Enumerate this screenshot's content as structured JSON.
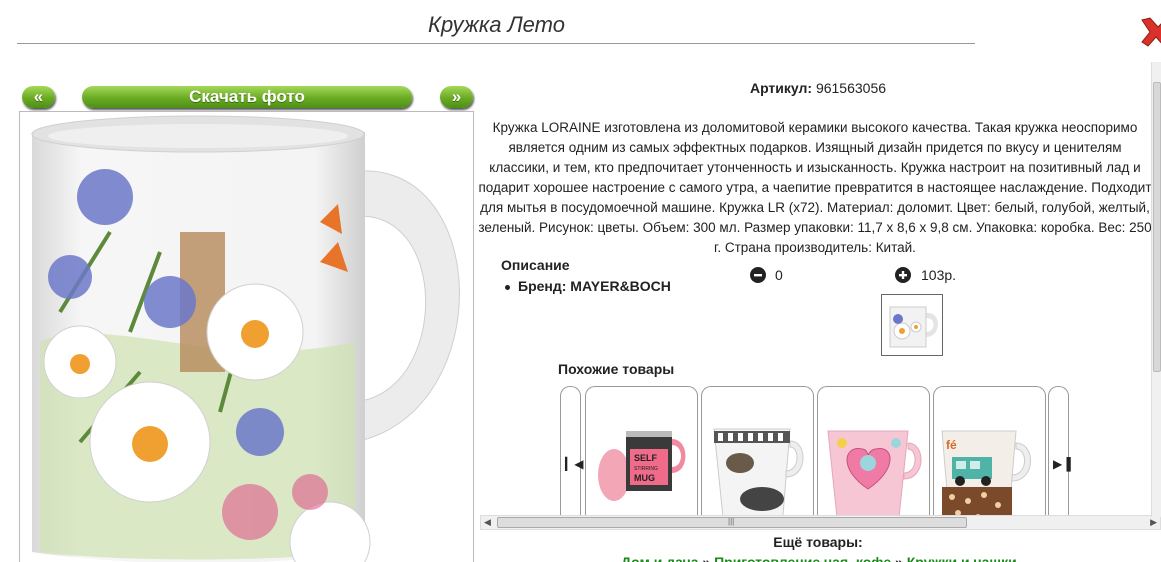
{
  "header": {
    "title": "Кружка Лето"
  },
  "gallery": {
    "prev_label": "«",
    "next_label": "»",
    "download_label": "Скачать фото"
  },
  "product": {
    "sku_label": "Артикул:",
    "sku_value": "961563056",
    "description": "Кружка LORAINE изготовлена из доломитовой керамики высокого качества. Такая кружка неоспоримо является одним из самых эффектных подарков. Изящный дизайн придется по вкусу и ценителям классики, и тем, кто предпочитает утонченность и изысканность. Кружка настроит на позитивный лад и подарит хорошее настроение с самого утра, а чаепитие превратится в настоящее наслаждение. Подходит для мытья в посудомоечной машине. Кружка LR (x72). Материал: доломит. Цвет: белый, голубой, желтый, зеленый. Рисунок: цветы. Объем: 300 мл. Размер упаковки: 11,7 х 8,6 х 9,8 см. Упаковка: коробка. Вес: 250 г. Страна производитель: Китай.",
    "specs_title": "Описание",
    "brand": "Бренд: MAYER&BOCH",
    "quantity": "0",
    "price": "103р."
  },
  "similar": {
    "title": "Похожие товары"
  },
  "more": {
    "title": "Ещё товары:",
    "crumbs": [
      "Дом и дача",
      "Приготовление чая, кофе",
      "Кружки и чашки"
    ],
    "separator": "»"
  }
}
